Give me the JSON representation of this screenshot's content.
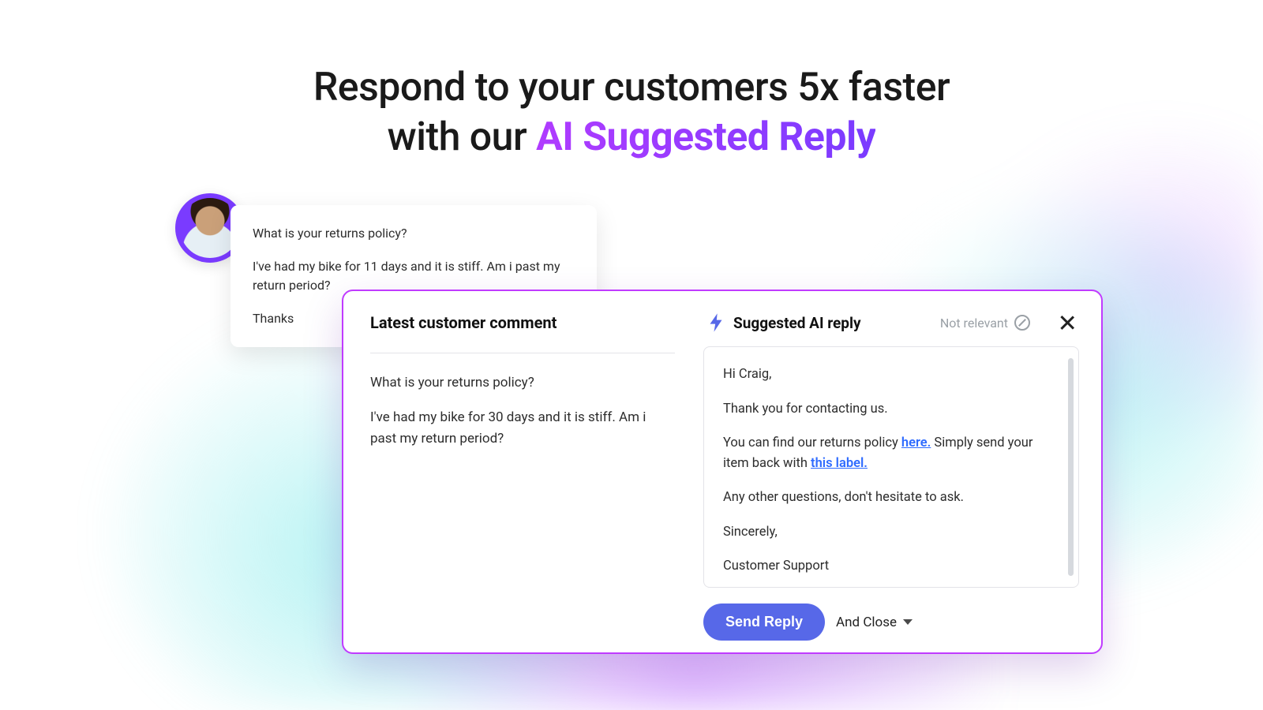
{
  "headline": {
    "line1_prefix": "Respond to your customers 5x faster",
    "line2_prefix": "with our ",
    "accent": "AI Suggested Reply"
  },
  "speech": {
    "q": "What is your returns policy?",
    "body": "I've had my bike for 11 days and it is stiff. Am i past my return period?",
    "signoff": "Thanks"
  },
  "panel": {
    "left": {
      "title": "Latest customer comment",
      "q": "What is your returns policy?",
      "body": "I've had my bike for 30 days and it is stiff. Am i past my return period?"
    },
    "right": {
      "title": "Suggested AI reply",
      "not_relevant": "Not relevant",
      "reply": {
        "greeting": "Hi Craig,",
        "thanks": "Thank you for contacting us.",
        "policy_prefix": "You can find our returns policy ",
        "policy_link": "here.",
        "policy_mid": " Simply send your item back with ",
        "label_link": "this label.",
        "any_other": "Any other questions, don't hesitate to ask.",
        "sincerely": "Sincerely,",
        "signature": "Customer Support"
      },
      "send_label": "Send Reply",
      "and_close": "And Close"
    }
  }
}
